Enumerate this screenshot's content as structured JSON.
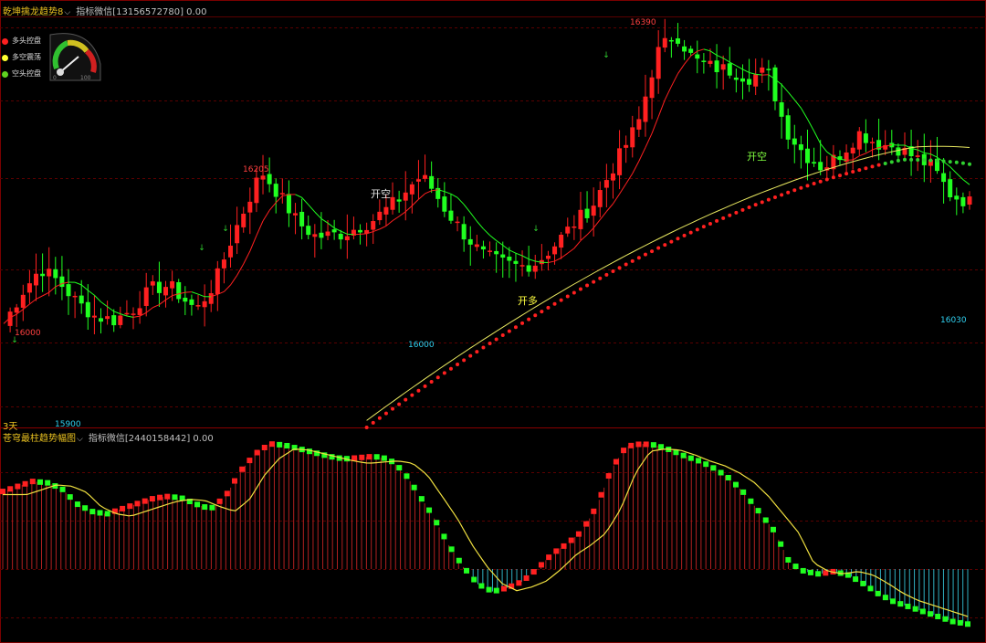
{
  "top_panel": {
    "indicator_name": "乾坤擒龙趋势8",
    "indicator_label": "指标微信[13156572780] 0.00",
    "legend": [
      {
        "label": "多头控盘",
        "color": "#ff2020"
      },
      {
        "label": "多空震荡",
        "color": "#ffff30"
      },
      {
        "label": "空头控盘",
        "color": "#60d020"
      }
    ],
    "gauge_labels": {
      "min": "0",
      "max": "100"
    },
    "bottom_left_text": "3天"
  },
  "bottom_panel": {
    "indicator_name": "苍穹最柱趋势幅图",
    "indicator_label": "指标微信[2440158442] 0.00"
  },
  "chart_data": [
    {
      "type": "candlestick",
      "price_labels": [
        {
          "text": "16000",
          "color": "#ff4040"
        },
        {
          "text": "15900",
          "color": "#30d0f0"
        },
        {
          "text": "16205",
          "color": "#ff4040"
        },
        {
          "text": "16000",
          "color": "#30d0f0"
        },
        {
          "text": "16390",
          "color": "#ff4040"
        },
        {
          "text": "16030",
          "color": "#30d0f0"
        }
      ],
      "signals": [
        {
          "text": "开空",
          "color": "#e0e0e0"
        },
        {
          "text": "开多",
          "color": "#ffff40"
        },
        {
          "text": "开空",
          "color": "#80ff40"
        }
      ],
      "close_path": [
        [
          0,
          16030
        ],
        [
          10,
          16075
        ],
        [
          20,
          16110
        ],
        [
          30,
          16090
        ],
        [
          40,
          16060
        ],
        [
          50,
          16040
        ],
        [
          60,
          16035
        ],
        [
          70,
          16050
        ],
        [
          80,
          16080
        ],
        [
          90,
          16085
        ],
        [
          100,
          16060
        ],
        [
          105,
          16050
        ],
        [
          115,
          16090
        ],
        [
          125,
          16160
        ],
        [
          135,
          16220
        ],
        [
          140,
          16250
        ],
        [
          150,
          16215
        ],
        [
          160,
          16175
        ],
        [
          170,
          16155
        ],
        [
          185,
          16160
        ],
        [
          200,
          16178
        ],
        [
          215,
          16210
        ],
        [
          225,
          16240
        ],
        [
          230,
          16236
        ],
        [
          240,
          16195
        ],
        [
          250,
          16160
        ],
        [
          260,
          16130
        ],
        [
          270,
          16118
        ],
        [
          280,
          16112
        ],
        [
          290,
          16118
        ],
        [
          300,
          16145
        ],
        [
          310,
          16175
        ],
        [
          320,
          16200
        ],
        [
          330,
          16250
        ],
        [
          345,
          16320
        ],
        [
          355,
          16420
        ],
        [
          365,
          16450
        ],
        [
          375,
          16410
        ],
        [
          385,
          16400
        ],
        [
          395,
          16395
        ],
        [
          405,
          16385
        ],
        [
          415,
          16395
        ],
        [
          425,
          16310
        ],
        [
          435,
          16275
        ],
        [
          445,
          16255
        ],
        [
          455,
          16275
        ],
        [
          465,
          16305
        ],
        [
          475,
          16290
        ],
        [
          485,
          16285
        ],
        [
          495,
          16270
        ],
        [
          505,
          16255
        ],
        [
          515,
          16215
        ],
        [
          525,
          16205
        ]
      ],
      "colors": {
        "up": "#ff2020",
        "down": "#20ff20"
      }
    },
    {
      "type": "bar",
      "series": [
        {
          "values": [
            0.62,
            0.66,
            0.7,
            0.69,
            0.64,
            0.52,
            0.46,
            0.44,
            0.48,
            0.52,
            0.56,
            0.58,
            0.57,
            0.52,
            0.48,
            0.58,
            0.78,
            0.92,
            1.0,
            0.99,
            0.96,
            0.93,
            0.9,
            0.88,
            0.89,
            0.9,
            0.88,
            0.78,
            0.6,
            0.42,
            0.2,
            0.02,
            -0.12,
            -0.18,
            -0.15,
            -0.1,
            0.0,
            0.12,
            0.2,
            0.3,
            0.5,
            0.8,
            0.98,
            1.0,
            0.99,
            0.95,
            0.9,
            0.86,
            0.8,
            0.72,
            0.6,
            0.45,
            0.3,
            0.05,
            -0.02,
            -0.04,
            -0.02,
            -0.05,
            -0.12,
            -0.2,
            -0.26,
            -0.3,
            -0.34,
            -0.38,
            -0.42,
            -0.44
          ]
        }
      ],
      "colors": {
        "up": "#ff2020",
        "down": "#20ff20"
      }
    }
  ]
}
